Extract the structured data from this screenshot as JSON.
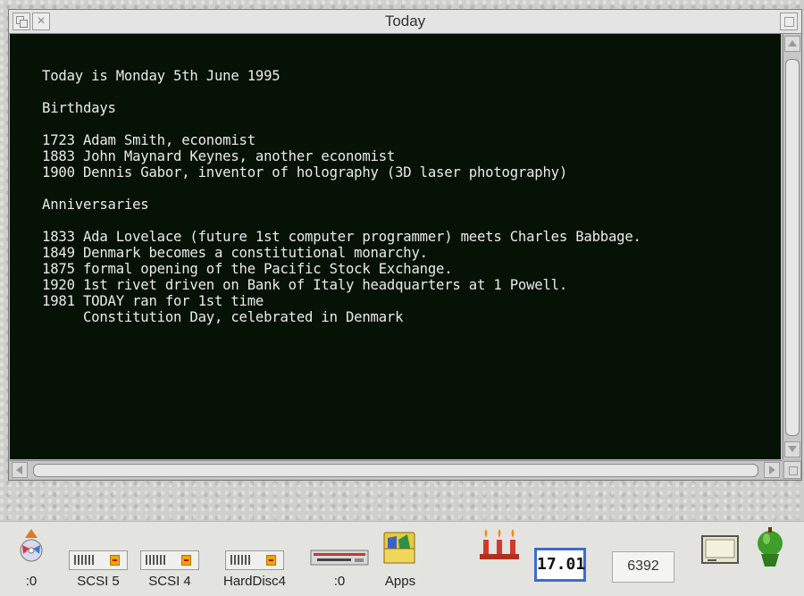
{
  "window": {
    "title": "Today"
  },
  "content": {
    "lines": [
      "Today is Monday 5th June 1995",
      "",
      "Birthdays",
      "",
      "1723 Adam Smith, economist",
      "1883 John Maynard Keynes, another economist",
      "1900 Dennis Gabor, inventor of holography (3D laser photography)",
      "",
      "Anniversaries",
      "",
      "1833 Ada Lovelace (future 1st computer programmer) meets Charles Babbage.",
      "1849 Denmark becomes a constitutional monarchy.",
      "1875 formal opening of the Pacific Stock Exchange.",
      "1920 1st rivet driven on Bank of Italy headquarters at 1 Powell.",
      "1981 TODAY ran for 1st time",
      "     Constitution Day, celebrated in Denmark"
    ]
  },
  "iconbar": {
    "items": [
      {
        "label": ":0",
        "icon": "cd-rom-icon"
      },
      {
        "label": "SCSI 5",
        "icon": "scsi-drive-icon"
      },
      {
        "label": "SCSI 4",
        "icon": "scsi-drive-icon"
      },
      {
        "label": "HardDisc4",
        "icon": "hard-disc-icon"
      },
      {
        "label": ":0",
        "icon": "floppy-drive-icon"
      },
      {
        "label": "Apps",
        "icon": "apps-folder-icon"
      }
    ],
    "clock": "17.01",
    "free_memory": "6392",
    "tray_icons": [
      "candles-icon",
      "display-icon",
      "acorn-icon"
    ]
  },
  "colors": {
    "pane_background": "#071207",
    "text": "#eaeaea",
    "clock_border": "#3a6ec7",
    "acorn_green": "#3f9d2a"
  }
}
